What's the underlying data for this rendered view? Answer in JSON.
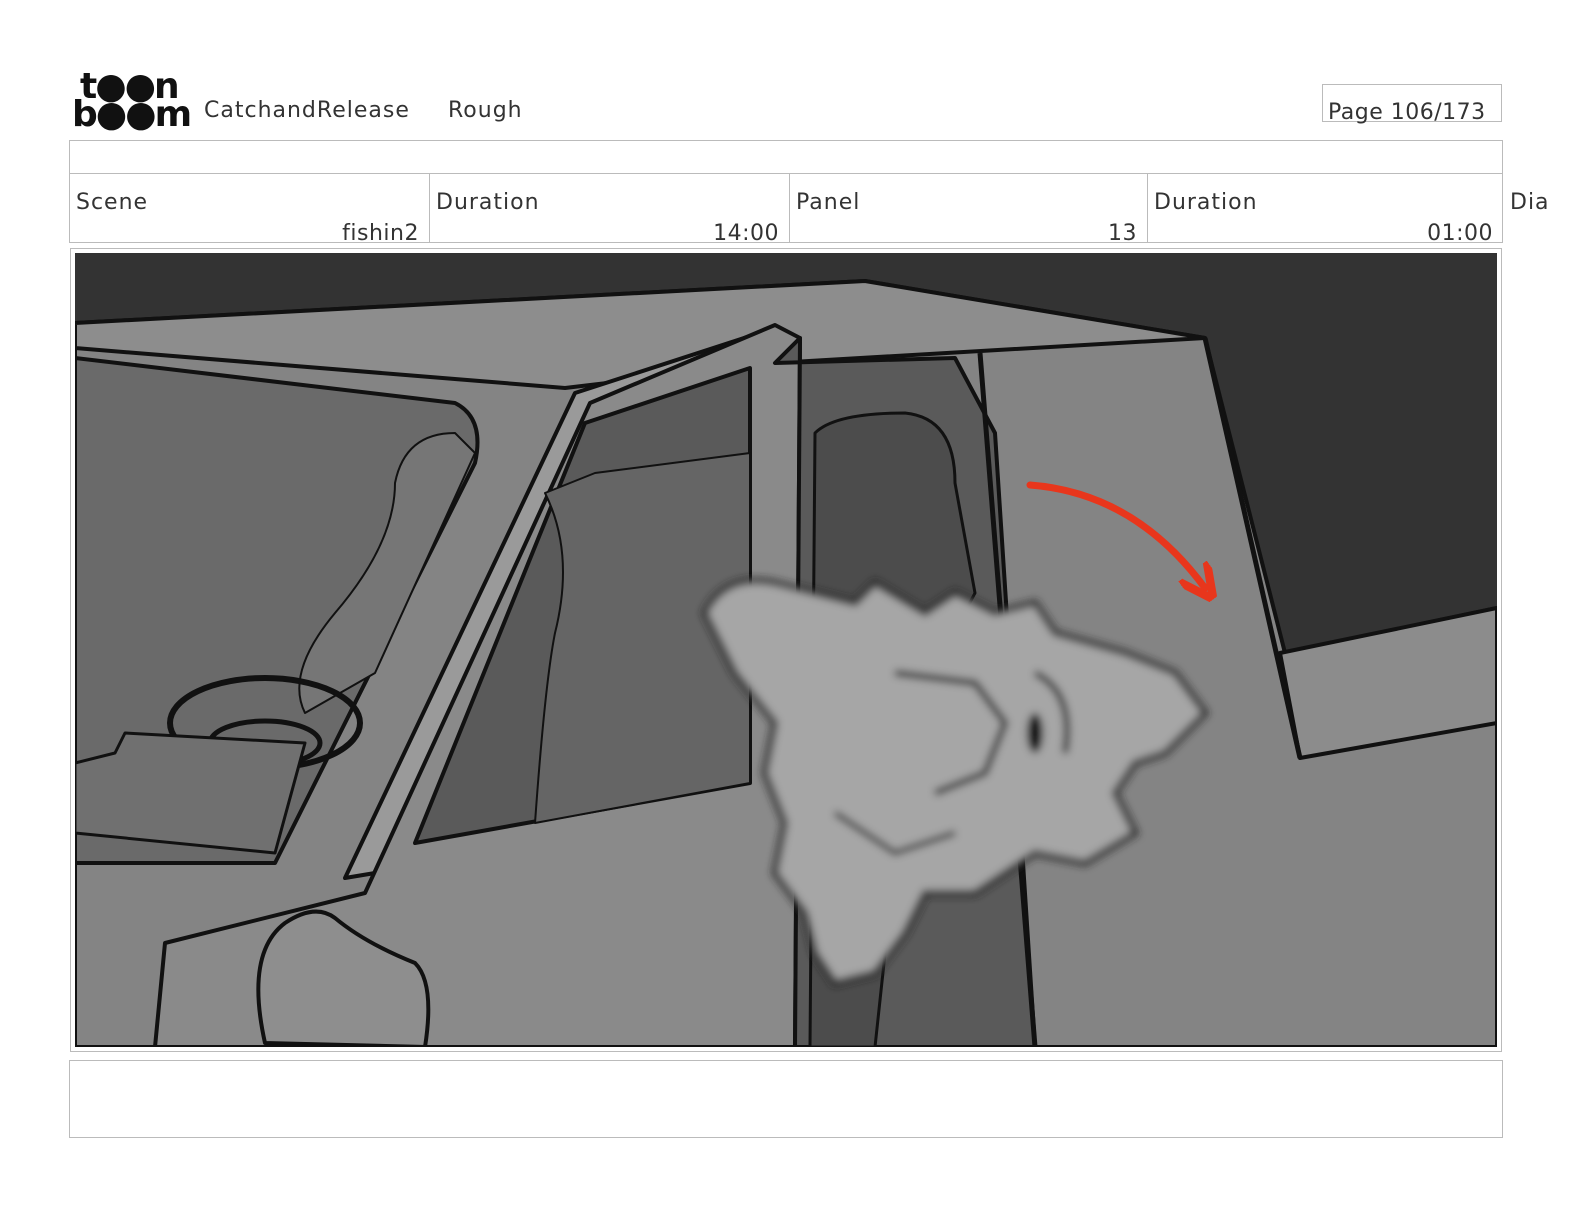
{
  "header": {
    "logo_line1": "t●●n",
    "logo_line2": "b●●m",
    "project": "CatchandRelease",
    "stage": "Rough",
    "page": "Page 106/173"
  },
  "fields": {
    "scene_label": "Scene",
    "scene_value": "fishin2",
    "scene_duration_label": "Duration",
    "scene_duration_value": "14:00",
    "panel_label": "Panel",
    "panel_value": "13",
    "panel_duration_label": "Duration",
    "panel_duration_value": "01:00",
    "dialog_label": "Dia"
  },
  "colors": {
    "accent_arrow": "#e8361c"
  }
}
